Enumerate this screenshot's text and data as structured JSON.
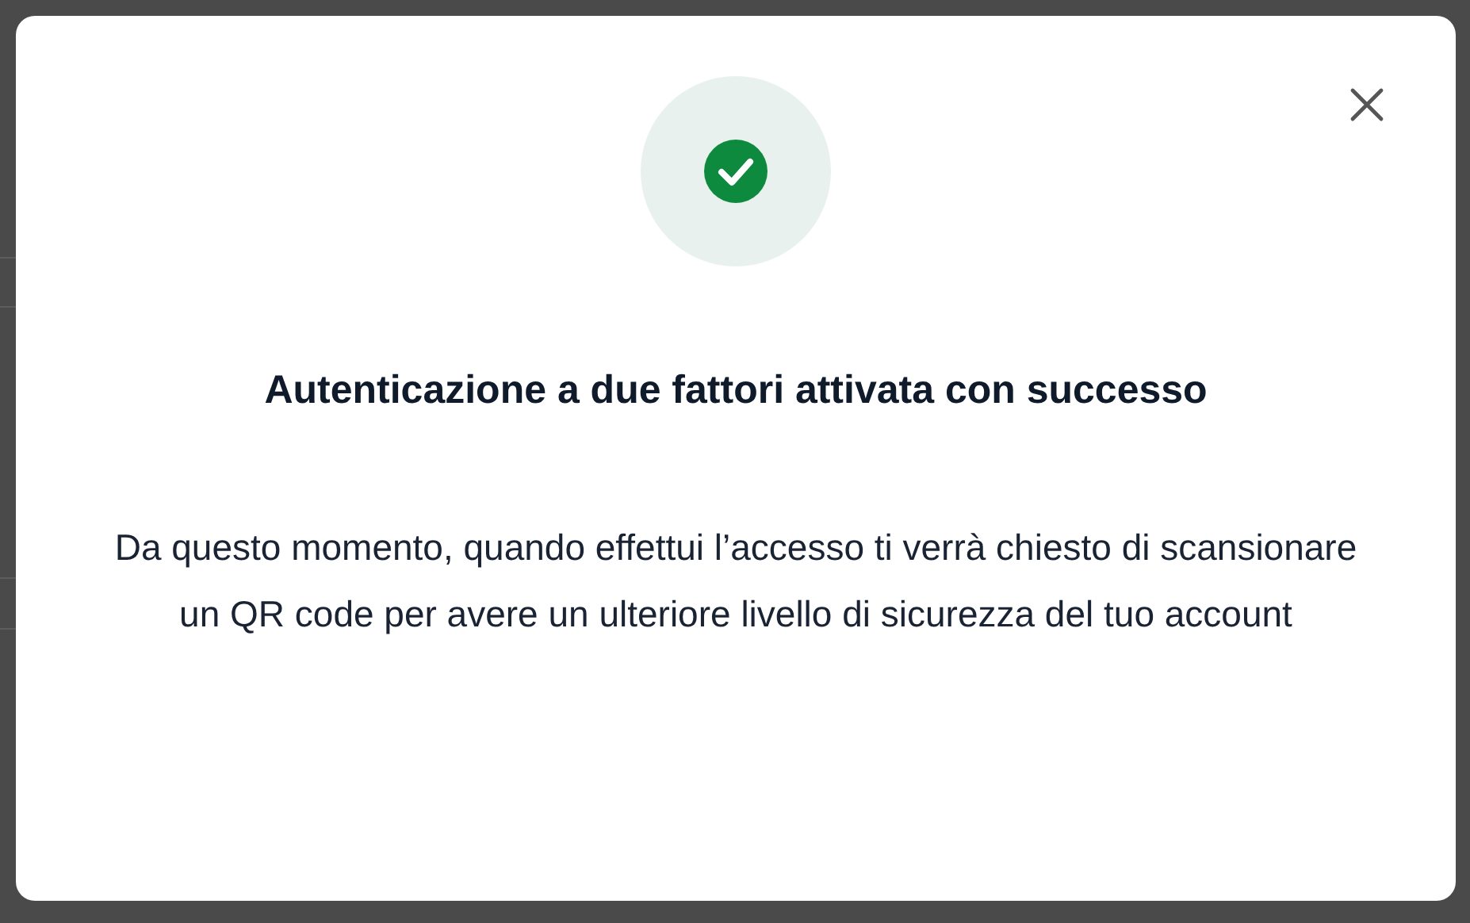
{
  "dialog": {
    "title": "Autenticazione a due fattori attivata con successo",
    "message": "Da questo momento, quando effettui l’accesso ti verrà chiesto di scansionare un QR code per avere un ulteriore livello di sicurezza del tuo account"
  }
}
